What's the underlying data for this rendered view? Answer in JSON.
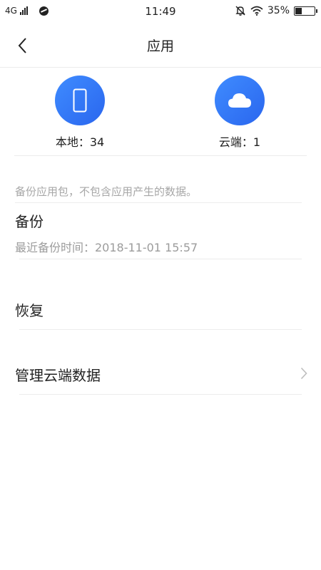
{
  "status_bar": {
    "network": "4G",
    "time": "11:49",
    "battery": "35%",
    "battery_level": 0.35,
    "icons": [
      "signal-icon",
      "globe-icon",
      "mute-bell-icon",
      "wifi-icon",
      "battery-icon"
    ]
  },
  "header": {
    "title": "应用",
    "back_icon": "chevron-left-icon"
  },
  "summary": {
    "local_label": "本地：34",
    "cloud_label": "云端：1",
    "icon_color_start": "#3f8cff",
    "icon_color_end": "#2a66ee"
  },
  "notice": "备份应用包，不包含应用产生的数据。",
  "backup": {
    "title": "备份",
    "subtitle": "最近备份时间：2018-11-01 15:57"
  },
  "restore": {
    "title": "恢复"
  },
  "manage": {
    "title": "管理云端数据",
    "icon": "chevron-right-icon"
  }
}
